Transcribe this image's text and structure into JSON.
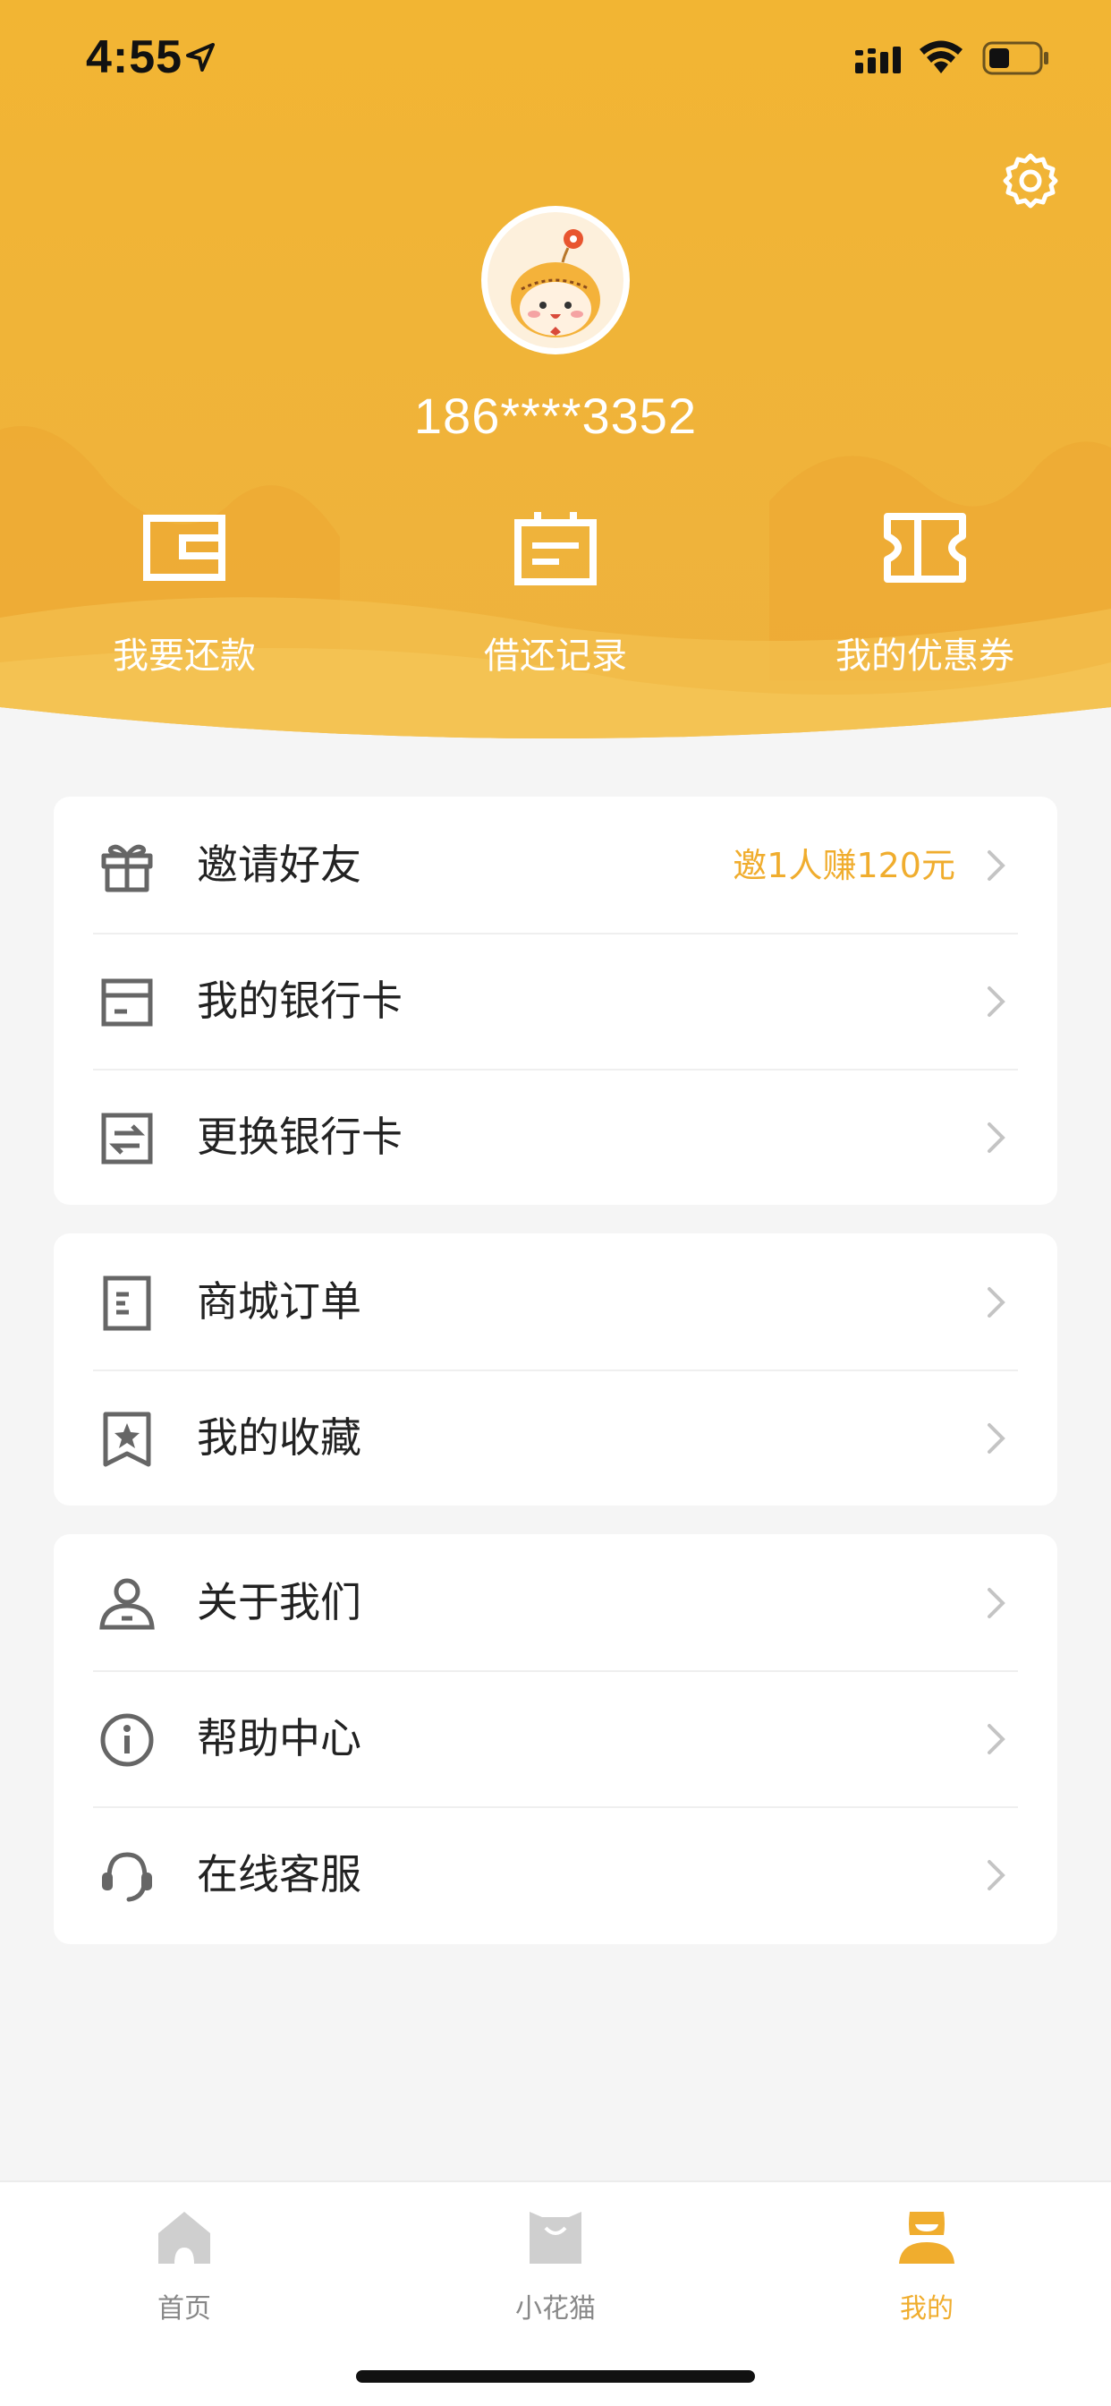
{
  "status_bar": {
    "time": "4:55"
  },
  "profile": {
    "phone": "186****3352"
  },
  "quick_actions": [
    {
      "label": "我要还款",
      "icon": "wallet-icon"
    },
    {
      "label": "借还记录",
      "icon": "calendar-icon"
    },
    {
      "label": "我的优惠券",
      "icon": "ticket-icon"
    }
  ],
  "menu_group_1": [
    {
      "label": "邀请好友",
      "extra": "邀1人赚120元",
      "icon": "gift-icon"
    },
    {
      "label": "我的银行卡",
      "icon": "bank-card-icon"
    },
    {
      "label": "更换银行卡",
      "icon": "swap-card-icon"
    }
  ],
  "menu_group_2": [
    {
      "label": "商城订单",
      "icon": "order-icon"
    },
    {
      "label": "我的收藏",
      "icon": "bookmark-star-icon"
    }
  ],
  "menu_group_3": [
    {
      "label": "关于我们",
      "icon": "person-icon"
    },
    {
      "label": "帮助中心",
      "icon": "info-icon"
    },
    {
      "label": "在线客服",
      "icon": "headset-icon"
    }
  ],
  "tabs": [
    {
      "label": "首页",
      "icon": "home-icon"
    },
    {
      "label": "小花猫",
      "icon": "shopping-bag-icon"
    },
    {
      "label": "我的",
      "icon": "profile-icon",
      "active": true
    }
  ],
  "colors": {
    "accent": "#f0ad2e",
    "header": "#f0b437",
    "icon_gray": "#666666"
  }
}
